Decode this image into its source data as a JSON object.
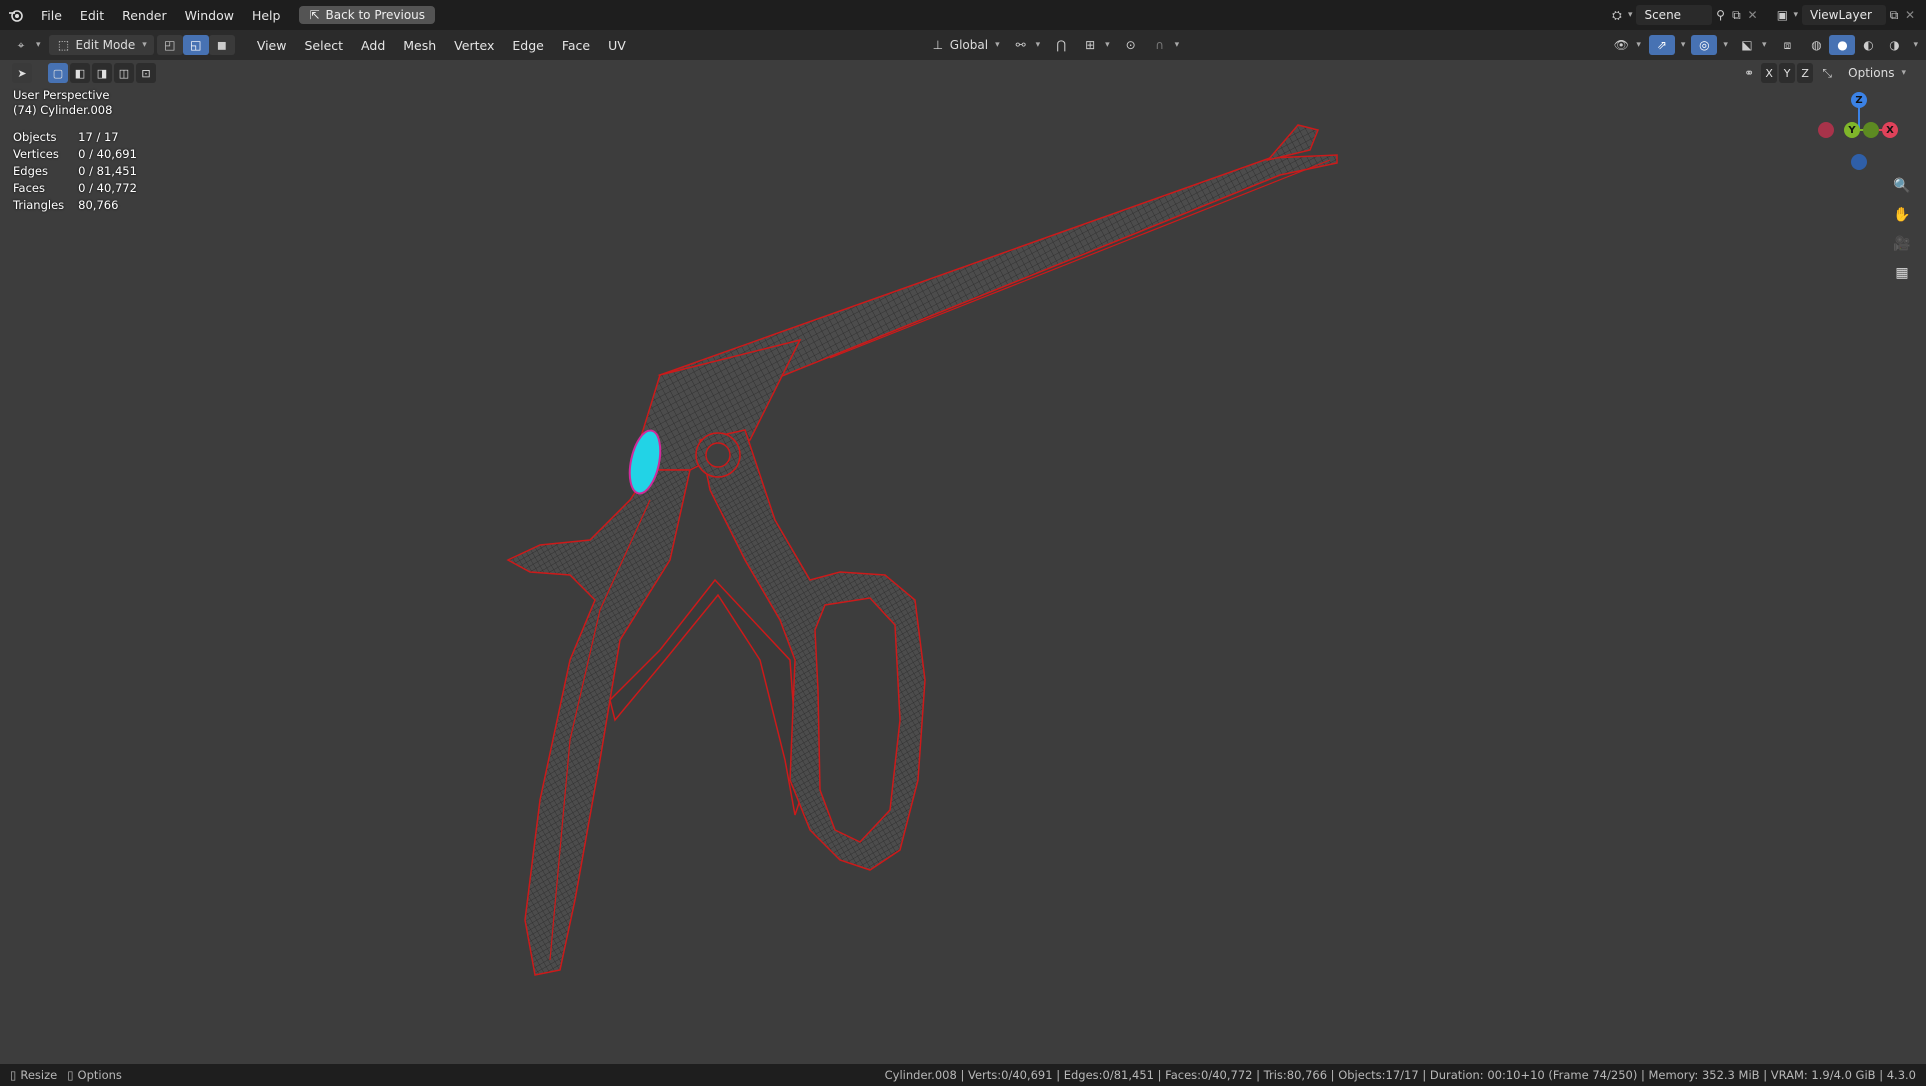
{
  "topbar": {
    "menus": [
      "File",
      "Edit",
      "Render",
      "Window",
      "Help"
    ],
    "back_button": "Back to Previous",
    "scene": "Scene",
    "view_layer": "ViewLayer"
  },
  "header": {
    "mode": "Edit Mode",
    "menus": [
      "View",
      "Select",
      "Add",
      "Mesh",
      "Vertex",
      "Edge",
      "Face",
      "UV"
    ],
    "orientation": "Global",
    "options_label": "Options",
    "axes": [
      "X",
      "Y",
      "Z"
    ]
  },
  "overlay": {
    "view_name": "User Perspective",
    "object_name": "(74) Cylinder.008",
    "stats": [
      {
        "label": "Objects",
        "value": "17 / 17"
      },
      {
        "label": "Vertices",
        "value": "0 / 40,691"
      },
      {
        "label": "Edges",
        "value": "0 / 81,451"
      },
      {
        "label": "Faces",
        "value": "0 / 40,772"
      },
      {
        "label": "Triangles",
        "value": "80,766"
      }
    ]
  },
  "gizmo": {
    "z": "Z",
    "y": "Y",
    "x": "X"
  },
  "status": {
    "left_resize": "Resize",
    "left_options": "Options",
    "right": "Cylinder.008 | Verts:0/40,691 | Edges:0/81,451 | Faces:0/40,772 | Tris:80,766 | Objects:17/17 | Duration: 00:10+10 (Frame 74/250) | Memory: 352.3 MiB | VRAM: 1.9/4.0 GiB | 4.3.0"
  },
  "colors": {
    "viewport_bg": "#3d3d3d",
    "wire_edge": "#cc1a1a",
    "mesh_fill": "#4a4a4a",
    "selection": "#22d3e6",
    "axis_x": "#e0425a",
    "axis_y": "#7fb62a",
    "axis_z": "#3b82e6"
  },
  "icons": [
    "blender-logo-icon",
    "editor-type-icon",
    "pivot-icon",
    "snap-icon",
    "proportional-edit-icon",
    "zoom-icon",
    "pan-hand-icon",
    "camera-icon",
    "grid-ortho-icon"
  ]
}
